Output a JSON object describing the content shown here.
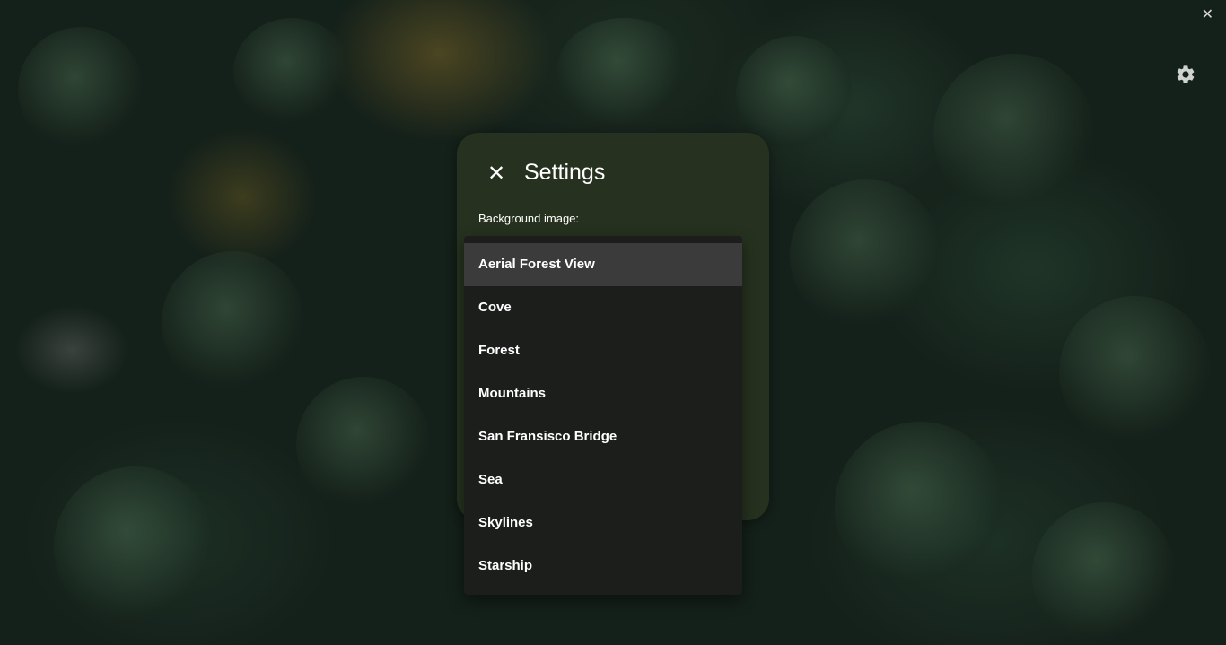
{
  "window": {
    "close_label": "✕"
  },
  "settings_panel": {
    "close_label": "✕",
    "title": "Settings",
    "background_label": "Background image:"
  },
  "dropdown": {
    "selected": "Aerial Forest View",
    "options": [
      {
        "label": "Aerial Forest View"
      },
      {
        "label": "Cove"
      },
      {
        "label": "Forest"
      },
      {
        "label": "Mountains"
      },
      {
        "label": "San Fransisco Bridge"
      },
      {
        "label": "Sea"
      },
      {
        "label": "Skylines"
      },
      {
        "label": "Starship"
      }
    ]
  },
  "colors": {
    "panel_bg": "#26321f",
    "dropdown_bg": "#1c1e1c",
    "selected_option_bg": "#3b3b3b",
    "text": "#ffffff"
  },
  "icons": {
    "settings": "gear-icon",
    "close": "close-icon"
  }
}
